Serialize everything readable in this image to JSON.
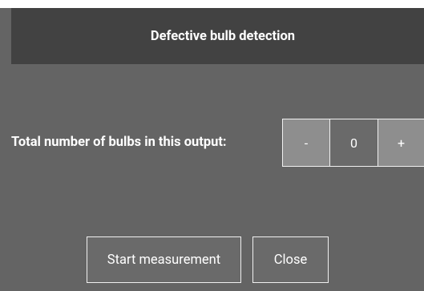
{
  "dialog": {
    "title": "Defective bulb detection"
  },
  "bulb_count": {
    "label": "Total number of bulbs in this output:",
    "decrement_label": "-",
    "value": "0",
    "increment_label": "+"
  },
  "buttons": {
    "start_label": "Start measurement",
    "close_label": "Close"
  },
  "colors": {
    "dialog_background": "#646464",
    "title_bar_background": "#424242",
    "stepper_button_background": "#8e8e8e",
    "border": "#f0f0f0",
    "text": "#ffffff"
  }
}
